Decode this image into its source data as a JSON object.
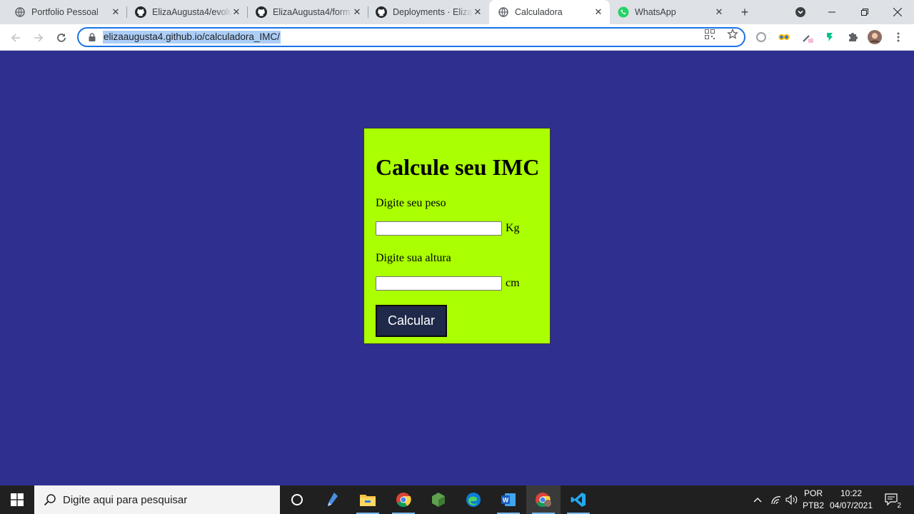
{
  "browser": {
    "tabs": [
      {
        "title": "Portfolio Pessoal",
        "icon": "globe-icon"
      },
      {
        "title": "ElizaAugusta4/evolu",
        "icon": "github-icon"
      },
      {
        "title": "ElizaAugusta4/form",
        "icon": "github-icon"
      },
      {
        "title": "Deployments · Eliza",
        "icon": "github-icon"
      },
      {
        "title": "Calculadora",
        "icon": "globe-icon",
        "active": true
      },
      {
        "title": "WhatsApp",
        "icon": "whatsapp-icon"
      }
    ],
    "url": "elizaaugusta4.github.io/calculadora_IMC/"
  },
  "page": {
    "title": "Calcule seu IMC",
    "weight_label": "Digite seu peso",
    "weight_value": "",
    "weight_unit": "Kg",
    "height_label": "Digite sua altura",
    "height_value": "",
    "height_unit": "cm",
    "button_label": "Calcular",
    "background_color": "#2f2f8f",
    "card_color": "#aaff00",
    "button_color": "#1f2a4a"
  },
  "taskbar": {
    "search_placeholder": "Digite aqui para pesquisar",
    "language_line1": "POR",
    "language_line2": "PTB2",
    "time": "10:22",
    "date": "04/07/2021",
    "notification_count": "2"
  }
}
